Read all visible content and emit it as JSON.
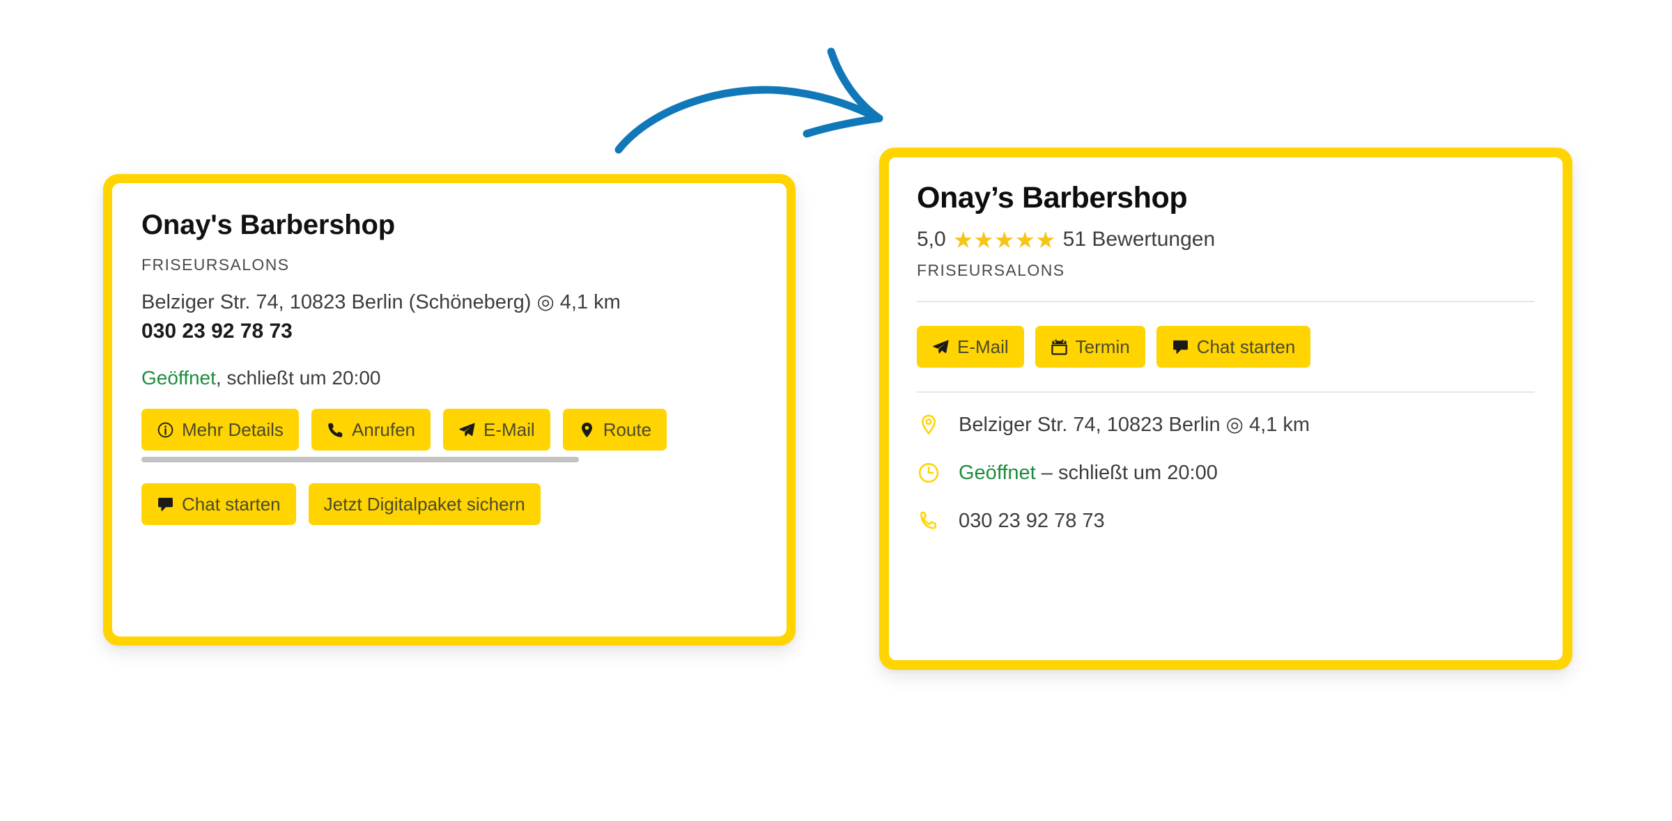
{
  "colors": {
    "brand_yellow": "#FFD400",
    "star_gold": "#F5C518",
    "open_green": "#1C8C3C",
    "arrow_blue": "#1077B8",
    "divider_grey": "#E6E6E6",
    "scrollbar_grey": "#C2C2C2"
  },
  "old_card": {
    "title": "Onay's Barbershop",
    "category": "FRISEURSALONS",
    "address": "Belziger Str. 74, 10823 Berlin (Schöneberg) ◎ 4,1 km",
    "phone": "030 23 92 78 73",
    "status": "Geöffnet",
    "status_suffix": ", schließt um 20:00",
    "buttons_row1": [
      {
        "label": "Mehr Details",
        "icon": "info-icon"
      },
      {
        "label": "Anrufen",
        "icon": "phone-icon"
      },
      {
        "label": "E-Mail",
        "icon": "paper-plane-icon"
      },
      {
        "label": "Route",
        "icon": "map-pin-icon"
      }
    ],
    "buttons_row2": [
      {
        "label": "Chat starten",
        "icon": "chat-bubble-icon"
      },
      {
        "label": "Jetzt Digitalpaket sichern",
        "icon": "none"
      }
    ]
  },
  "new_card": {
    "title": "Onay’s Barbershop",
    "rating_value": "5,0",
    "stars": "★★★★★",
    "rating_count": "51 Bewertungen",
    "category": "FRISEURSALONS",
    "buttons": [
      {
        "label": "E-Mail",
        "icon": "paper-plane-icon"
      },
      {
        "label": "Termin",
        "icon": "calendar-icon"
      },
      {
        "label": "Chat starten",
        "icon": "chat-bubble-icon"
      }
    ],
    "info": [
      {
        "icon": "map-pin-outline-icon",
        "text": "Belziger Str. 74, 10823 Berlin ◎ 4,1 km"
      },
      {
        "icon": "clock-outline-icon",
        "status": "Geöffnet",
        "status_suffix": " – schließt um 20:00"
      },
      {
        "icon": "phone-outline-icon",
        "text": "030 23 92 78 73"
      }
    ]
  }
}
